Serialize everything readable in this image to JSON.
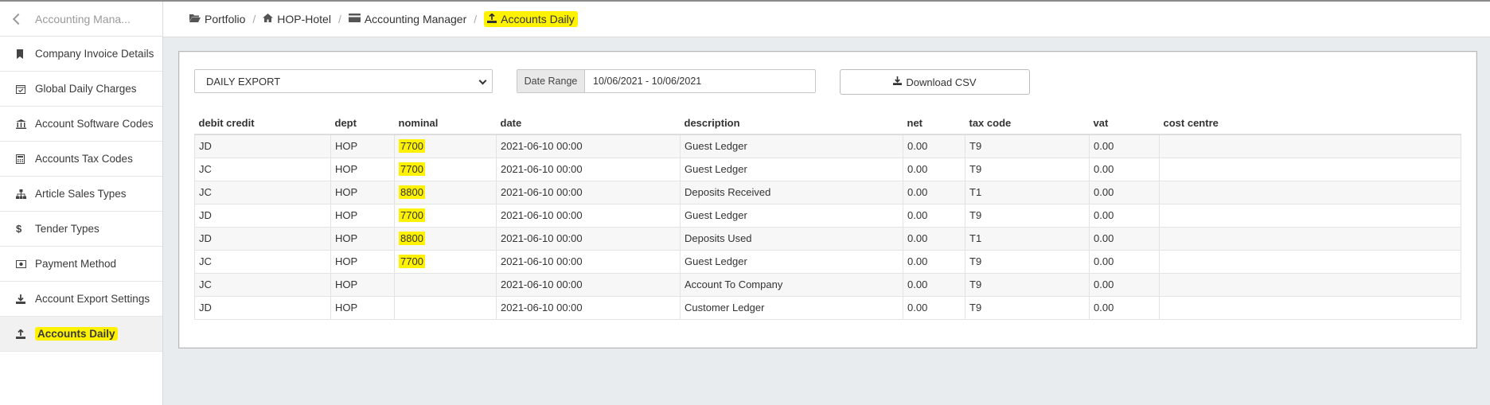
{
  "sidebar": {
    "back_label": "Accounting Mana...",
    "items": [
      {
        "label": "Company Invoice Details",
        "icon": "bookmark-icon"
      },
      {
        "label": "Global Daily Charges",
        "icon": "calendar-check-icon"
      },
      {
        "label": "Account Software Codes",
        "icon": "bank-icon"
      },
      {
        "label": "Accounts Tax Codes",
        "icon": "calculator-icon"
      },
      {
        "label": "Article Sales Types",
        "icon": "sitemap-icon"
      },
      {
        "label": "Tender Types",
        "icon": "dollar-icon"
      },
      {
        "label": "Payment Method",
        "icon": "money-icon"
      },
      {
        "label": "Account Export Settings",
        "icon": "download-icon"
      },
      {
        "label": "Accounts Daily",
        "icon": "upload-icon"
      }
    ]
  },
  "breadcrumb": {
    "portfolio": "Portfolio",
    "hotel": "HOP-Hotel",
    "manager": "Accounting Manager",
    "current": "Accounts Daily"
  },
  "controls": {
    "export_type": "DAILY EXPORT",
    "date_range_label": "Date Range",
    "date_range_value": "10/06/2021 - 10/06/2021",
    "download_label": "Download CSV"
  },
  "table": {
    "headers": [
      "debit credit",
      "dept",
      "nominal",
      "date",
      "description",
      "net",
      "tax code",
      "vat",
      "cost centre"
    ],
    "rows": [
      [
        "JD",
        "HOP",
        "7700",
        "2021-06-10 00:00",
        "Guest Ledger",
        "0.00",
        "T9",
        "0.00",
        ""
      ],
      [
        "JC",
        "HOP",
        "7700",
        "2021-06-10 00:00",
        "Guest Ledger",
        "0.00",
        "T9",
        "0.00",
        ""
      ],
      [
        "JC",
        "HOP",
        "8800",
        "2021-06-10 00:00",
        "Deposits Received",
        "0.00",
        "T1",
        "0.00",
        ""
      ],
      [
        "JD",
        "HOP",
        "7700",
        "2021-06-10 00:00",
        "Guest Ledger",
        "0.00",
        "T9",
        "0.00",
        ""
      ],
      [
        "JD",
        "HOP",
        "8800",
        "2021-06-10 00:00",
        "Deposits Used",
        "0.00",
        "T1",
        "0.00",
        ""
      ],
      [
        "JC",
        "HOP",
        "7700",
        "2021-06-10 00:00",
        "Guest Ledger",
        "0.00",
        "T9",
        "0.00",
        ""
      ],
      [
        "JC",
        "HOP",
        "",
        "2021-06-10 00:00",
        "Account To Company",
        "0.00",
        "T9",
        "0.00",
        ""
      ],
      [
        "JD",
        "HOP",
        "",
        "2021-06-10 00:00",
        "Customer Ledger",
        "0.00",
        "T9",
        "0.00",
        ""
      ]
    ]
  },
  "colors": {
    "highlight": "#fff200",
    "background": "#e9ecef"
  }
}
